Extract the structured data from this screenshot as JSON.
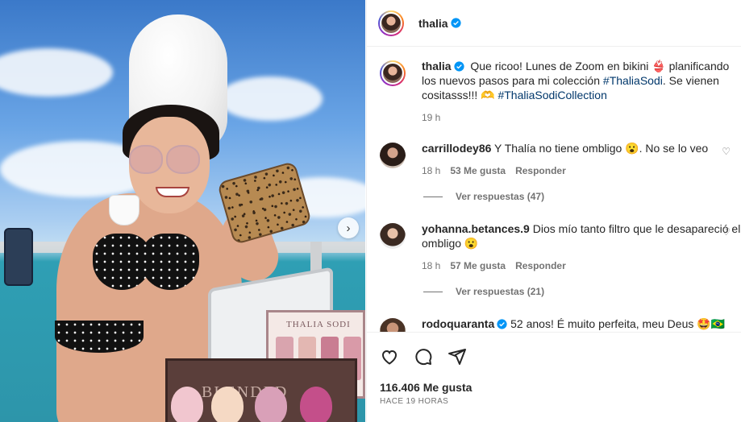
{
  "post": {
    "author": "thalia",
    "caption_parts": [
      {
        "text": "Que ricoo! Lunes de Zoom en bikini 👙 planificando los nuevos pasos para mi colección ",
        "tag": false
      },
      {
        "text": "#ThaliaSodi",
        "tag": true
      },
      {
        "text": ". Se vienen cositasss!!! 🫶 ",
        "tag": false
      },
      {
        "text": "#ThaliaSodiCollection",
        "tag": true
      }
    ],
    "caption_time": "19 h",
    "likes": "116.406 Me gusta",
    "posted_ago": "HACE 19 HORAS"
  },
  "photo": {
    "box_brand": "THALIA SODI",
    "box_product": "BLENDED"
  },
  "comments": [
    {
      "user": "carrillodey86",
      "verified": false,
      "text": "Y Thalía no tiene ombligo 😮. No se lo veo",
      "time": "18 h",
      "likes": "53 Me gusta",
      "reply": "Responder",
      "replies": "Ver respuestas (47)"
    },
    {
      "user": "yohanna.betances.9",
      "verified": false,
      "text": "Dios mío tanto filtro que le desapareció el ombligo 😮",
      "time": "18 h",
      "likes": "57 Me gusta",
      "reply": "Responder",
      "replies": "Ver respuestas (21)"
    },
    {
      "user": "rodoquaranta",
      "verified": true,
      "text": "52 anos! É muito perfeita, meu Deus 🤩🇧🇷",
      "time": "",
      "likes": "",
      "reply": "",
      "replies": ""
    }
  ],
  "icons": [
    "heart-icon",
    "comment-icon",
    "share-icon"
  ],
  "colors": {
    "verified": "#0095f6",
    "hashtag": "#00376b",
    "muted": "#737373"
  }
}
